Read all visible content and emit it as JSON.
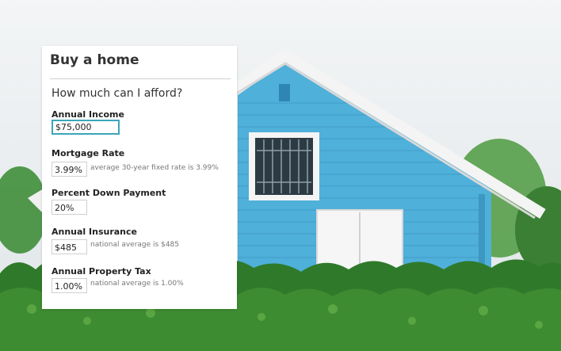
{
  "card": {
    "title": "Buy a home",
    "subtitle": "How much can I afford?",
    "fields": [
      {
        "label": "Annual Income",
        "value": "$75,000",
        "hint": ""
      },
      {
        "label": "Mortgage Rate",
        "value": "3.99%",
        "hint": "average 30-year fixed rate is 3.99%"
      },
      {
        "label": "Percent Down Payment",
        "value": "20%",
        "hint": ""
      },
      {
        "label": "Annual Insurance",
        "value": "$485",
        "hint": "national average is $485"
      },
      {
        "label": "Annual Property Tax",
        "value": "1.00%",
        "hint": "national average is 1.00%"
      }
    ]
  },
  "colors": {
    "accent_focus": "#3aa6b9",
    "house_blue": "#4fb0da",
    "trim_white": "#f2f2f2",
    "hedge_green": "#2f7a2a"
  }
}
